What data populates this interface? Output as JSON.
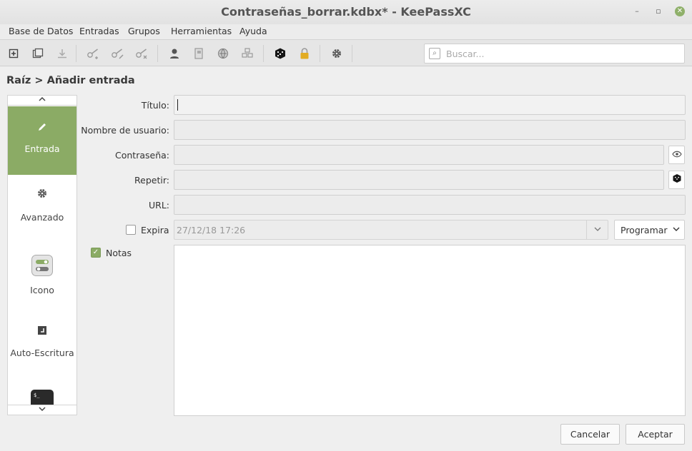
{
  "window": {
    "title": "Contraseñas_borrar.kdbx* - KeePassXC",
    "minimize": "–",
    "maximize": "▫",
    "close": "✕"
  },
  "menu": [
    "Base de Datos",
    "Entradas",
    "Grupos",
    "Herramientas",
    "Ayuda"
  ],
  "toolbar": {
    "icons": [
      "new-database-icon",
      "open-database-icon",
      "save-database-icon",
      "add-entry-icon",
      "edit-entry-icon",
      "delete-entry-icon",
      "copy-username-icon",
      "copy-password-icon",
      "copy-url-icon",
      "autotype-icon",
      "password-generator-icon",
      "lock-database-icon",
      "settings-icon"
    ],
    "search_placeholder": "Buscar..."
  },
  "breadcrumb": "Raíz > Añadir entrada",
  "sidebar": {
    "items": [
      {
        "label": "Entrada",
        "icon": "pencil-icon",
        "active": true
      },
      {
        "label": "Avanzado",
        "icon": "gear-icon",
        "active": false
      },
      {
        "label": "Icono",
        "icon": "toggle-icon",
        "active": false
      },
      {
        "label": "Auto-Escritura",
        "icon": "keyboard-icon",
        "active": false
      },
      {
        "label": "",
        "icon": "terminal-icon",
        "active": false
      }
    ]
  },
  "form": {
    "title_label": "Título:",
    "title_value": "",
    "username_label": "Nombre de usuario:",
    "username_value": "",
    "password_label": "Contraseña:",
    "password_value": "",
    "repeat_label": "Repetir:",
    "repeat_value": "",
    "url_label": "URL:",
    "url_value": "",
    "expires_label": "Expira",
    "expires_checked": false,
    "expires_value": "27/12/18 17:26",
    "presets_label": "Programar",
    "notes_label": "Notas",
    "notes_checked": true,
    "notes_value": ""
  },
  "buttons": {
    "cancel": "Cancelar",
    "accept": "Aceptar"
  }
}
